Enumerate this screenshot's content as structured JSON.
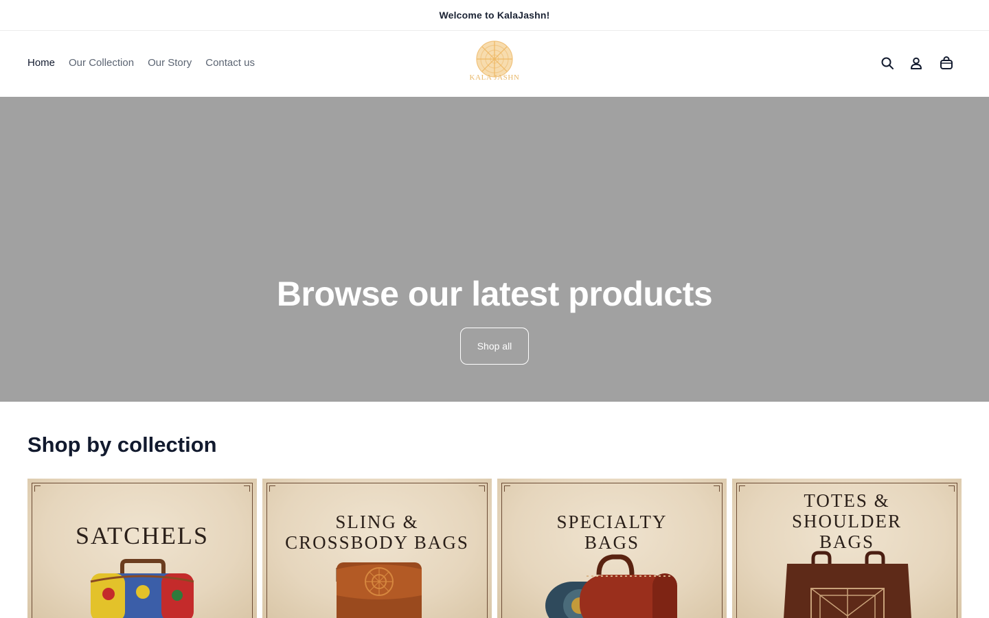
{
  "announcement": {
    "text": "Welcome to KalaJashn!"
  },
  "header": {
    "nav": [
      {
        "label": "Home",
        "active": true
      },
      {
        "label": "Our Collection"
      },
      {
        "label": "Our Story"
      },
      {
        "label": "Contact us"
      }
    ],
    "logo": {
      "text": "KALA JASHN",
      "color": "#e8b86a"
    },
    "icons": [
      "search-icon",
      "account-icon",
      "cart-icon"
    ]
  },
  "hero": {
    "title": "Browse our latest products",
    "button_label": "Shop all",
    "background": "#a1a1a1"
  },
  "collections": {
    "title": "Shop by collection",
    "items": [
      {
        "line1": "SATCHELS",
        "line2": ""
      },
      {
        "line1": "SLING &",
        "line2": "CROSSBODY BAGS"
      },
      {
        "line1": "SPECIALTY",
        "line2": "BAGS"
      },
      {
        "line1": "TOTES &",
        "line2": "SHOULDER",
        "line3": "BAGS"
      }
    ]
  },
  "colors": {
    "text": "#121a2e",
    "muted": "#5b6472",
    "card_bg": "#e6d6bd",
    "frame": "#6b4a33"
  }
}
